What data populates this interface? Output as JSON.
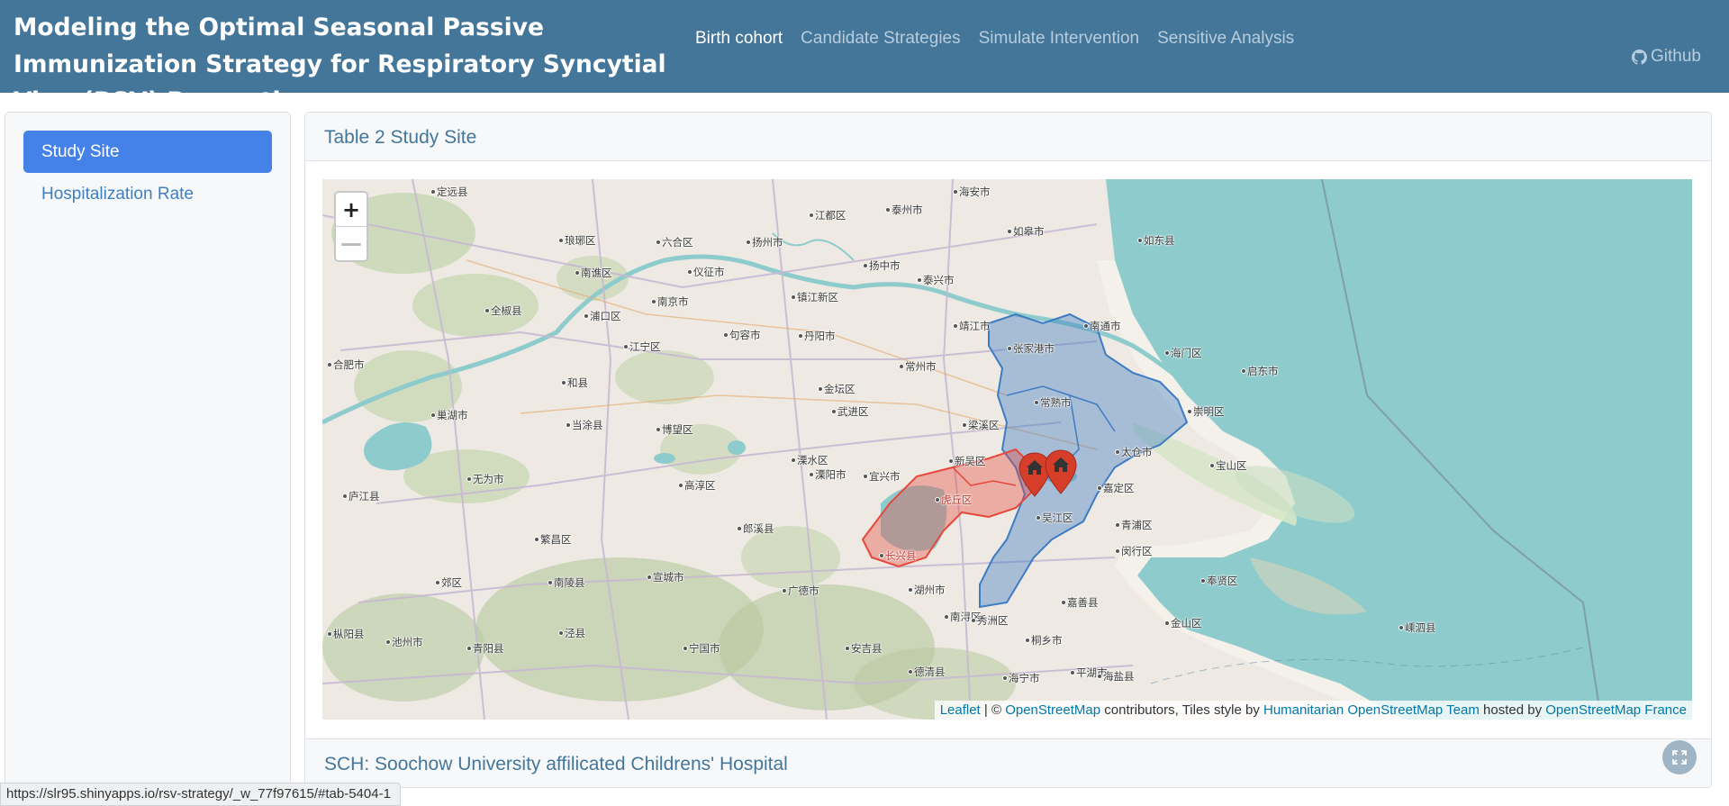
{
  "navbar": {
    "title": "Modeling the Optimal Seasonal Passive Immunization Strategy for Respiratory Syncytial Virus(RSV) Prevention",
    "links": [
      {
        "label": "Birth cohort",
        "active": true
      },
      {
        "label": "Candidate Strategies",
        "active": false
      },
      {
        "label": "Simulate Intervention",
        "active": false
      },
      {
        "label": "Sensitive Analysis",
        "active": false
      }
    ],
    "github_label": "Github",
    "github_icon": "github-icon"
  },
  "sidebar": {
    "items": [
      {
        "label": "Study Site",
        "active": true
      },
      {
        "label": "Hospitalization Rate",
        "active": false
      }
    ]
  },
  "card": {
    "title": "Table 2 Study Site",
    "footer": "SCH: Soochow University affilicated Childrens' Hospital",
    "expand_icon": "expand-icon"
  },
  "map": {
    "zoom_in": "+",
    "zoom_out": "—",
    "attribution": {
      "leaflet": "Leaflet",
      "sep": " | © ",
      "osm": "OpenStreetMap",
      "mid": " contributors, Tiles style by ",
      "hot": "Humanitarian OpenStreetMap Team",
      "hosted": " hosted by ",
      "osmfr": "OpenStreetMap France"
    },
    "region_colors": {
      "blue": "#3d7bc4",
      "red": "#e8473c"
    },
    "marker_color": "#d63e2a",
    "marker_icon": "home-icon",
    "labels": [
      "定远县",
      "海安市",
      "江都区",
      "泰州市",
      "如皋市",
      "如东县",
      "琅琊区",
      "六合区",
      "扬州市",
      "南谯区",
      "仪征市",
      "扬中市",
      "泰兴市",
      "全椒县",
      "浦口区",
      "南京市",
      "镇江新区",
      "靖江市",
      "南通市",
      "合肥市",
      "江宁区",
      "句容市",
      "丹阳市",
      "张家港市",
      "海门区",
      "启东市",
      "和县",
      "金坛区",
      "常州市",
      "常熟市",
      "崇明区",
      "巢湖市",
      "当涂县",
      "博望区",
      "武进区",
      "梁溪区",
      "太仓市",
      "宝山区",
      "无为市",
      "溧阳市",
      "溧水区",
      "高淳区",
      "宜兴市",
      "新吴区",
      "嘉定区",
      "庐江县",
      "吴江区",
      "青浦区",
      "繁昌区",
      "泾县",
      "广德市",
      "郎溪县",
      "南陵县",
      "宣城市",
      "湖州市",
      "南浔区",
      "嘉善县",
      "金山区",
      "奉贤区",
      "闵行区",
      "枞阳县",
      "池州市",
      "青阳县",
      "宁国市",
      "安吉县",
      "德清县",
      "桐乡市",
      "平湖市",
      "海宁市",
      "海盐县",
      "郊区",
      "秀洲区",
      "嵊泗县",
      "长兴县",
      "虎丘区"
    ]
  },
  "status_url": "https://slr95.shinyapps.io/rsv-strategy/_w_77f97615/#tab-5404-1"
}
